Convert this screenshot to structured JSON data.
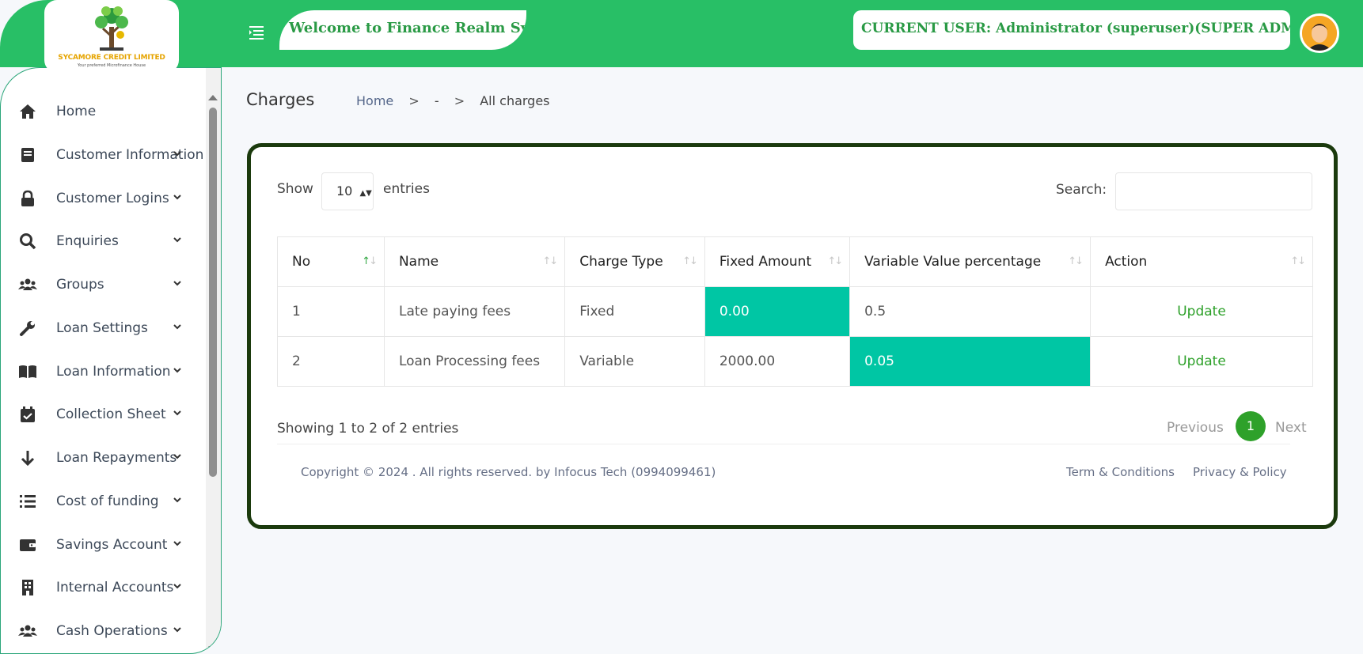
{
  "header": {
    "logo_title": "SYCAMORE CREDIT LIMITED",
    "logo_subtitle": "Your preferred Microfinance House",
    "welcome": "Welcome to Finance Realm System",
    "current_user": "CURRENT USER: Administrator (superuser)(SUPER ADMIN)",
    "brand_color": "#28bf66"
  },
  "sidebar": {
    "items": [
      {
        "label": "Home",
        "icon": "home-icon"
      },
      {
        "label": "Customer Information",
        "icon": "book-icon"
      },
      {
        "label": "Customer Logins",
        "icon": "lock-icon"
      },
      {
        "label": "Enquiries",
        "icon": "search-icon"
      },
      {
        "label": "Groups",
        "icon": "users-icon"
      },
      {
        "label": "Loan Settings",
        "icon": "wrench-icon"
      },
      {
        "label": "Loan Information",
        "icon": "open-book-icon"
      },
      {
        "label": "Collection Sheet",
        "icon": "calendar-check-icon"
      },
      {
        "label": "Loan Repayments",
        "icon": "arrow-down-icon"
      },
      {
        "label": "Cost of funding",
        "icon": "list-icon"
      },
      {
        "label": "Savings Account",
        "icon": "wallet-icon"
      },
      {
        "label": "Internal Accounts",
        "icon": "building-icon"
      },
      {
        "label": "Cash Operations",
        "icon": "users-icon"
      }
    ]
  },
  "page": {
    "title": "Charges",
    "breadcrumb": {
      "home": "Home",
      "sep1": ">",
      "middle": "-",
      "sep2": ">",
      "current": "All charges"
    }
  },
  "table_controls": {
    "show_label": "Show",
    "page_length": "10",
    "entries_label": "entries",
    "search_label": "Search:",
    "search_value": ""
  },
  "table": {
    "columns": [
      "No",
      "Name",
      "Charge Type",
      "Fixed Amount",
      "Variable Value percentage",
      "Action"
    ],
    "rows": [
      {
        "no": "1",
        "name": "Late paying fees",
        "type": "Fixed",
        "fixed": "0.00",
        "variable": "0.5",
        "action": "Update"
      },
      {
        "no": "2",
        "name": "Loan Processing fees",
        "type": "Variable",
        "fixed": "2000.00",
        "variable": "0.05",
        "action": "Update"
      }
    ],
    "highlight_color": "#00c6a4"
  },
  "pagination": {
    "info": "Showing 1 to 2 of 2 entries",
    "previous": "Previous",
    "current": "1",
    "next": "Next"
  },
  "footer": {
    "copyright": "Copyright © 2024 . All rights reserved. by Infocus Tech (0994099461)",
    "terms": "Term & Conditions",
    "privacy": "Privacy & Policy"
  }
}
